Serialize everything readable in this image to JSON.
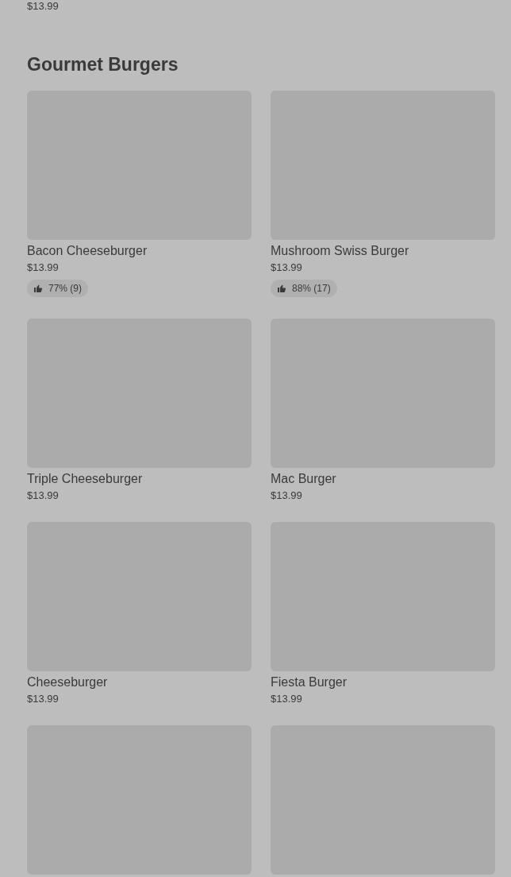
{
  "previous_item_price": "$13.99",
  "section": {
    "title": "Gourmet Burgers",
    "items": [
      {
        "kind": "item",
        "name": "Bacon Cheeseburger",
        "price": "$13.99",
        "rating": "77% (9)"
      },
      {
        "kind": "item",
        "name": "Mushroom Swiss Burger",
        "price": "$13.99",
        "rating": "88% (17)"
      },
      {
        "kind": "item",
        "name": "Triple Cheeseburger",
        "price": "$13.99"
      },
      {
        "kind": "item",
        "name": "Mac Burger",
        "price": "$13.99"
      },
      {
        "kind": "item",
        "name": "Cheeseburger",
        "price": "$13.99"
      },
      {
        "kind": "item",
        "name": "Fiesta Burger",
        "price": "$13.99"
      },
      {
        "kind": "picture"
      },
      {
        "kind": "picture"
      }
    ]
  }
}
